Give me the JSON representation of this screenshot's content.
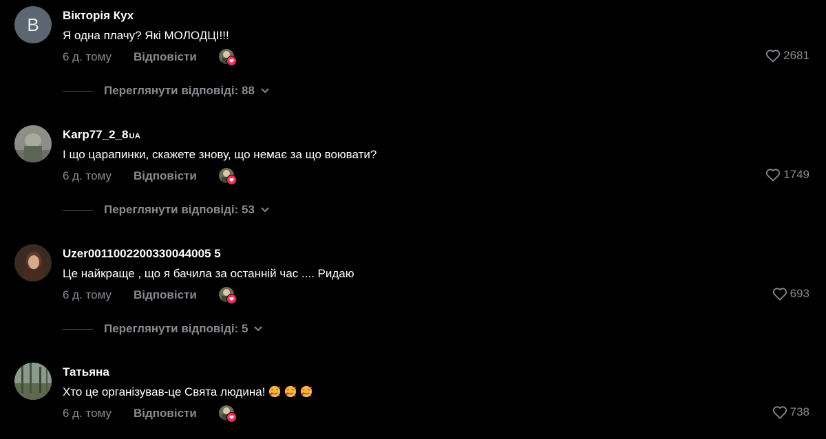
{
  "comments": [
    {
      "avatar_letter": "В",
      "username": "Вікторія Кух",
      "username_suffix": "",
      "text": "Я одна плачу? Які МОЛОДЦІ!!!",
      "time": "6 д. тому",
      "reply_label": "Відповісти",
      "likes": "2681",
      "view_replies": "Переглянути відповіді: 88"
    },
    {
      "avatar_letter": "",
      "username": "Karp77_2_8",
      "username_suffix": "UA",
      "text": "І що царапинки, скажете знову, що немає за що воювати?",
      "time": "6 д. тому",
      "reply_label": "Відповісти",
      "likes": "1749",
      "view_replies": "Переглянути відповіді: 53"
    },
    {
      "avatar_letter": "",
      "username": "Uzer0011002200330044005 5",
      "username_suffix": "",
      "text": "Це найкраще , що я бачила за останній час .... Ридаю",
      "time": "6 д. тому",
      "reply_label": "Відповісти",
      "likes": "693",
      "view_replies": "Переглянути відповіді: 5"
    },
    {
      "avatar_letter": "",
      "username": "Татьяна",
      "username_suffix": "",
      "text": "Хто це організував-це Свята людина!",
      "time": "6 д. тому",
      "reply_label": "Відповісти",
      "likes": "738",
      "view_replies": ""
    }
  ],
  "icons": {
    "like": "heart-outline-icon",
    "expand": "chevron-down-icon",
    "creator_liked": "creator-liked-badge-icon",
    "emoji": "smiling-face-with-hearts-emoji"
  },
  "colors": {
    "background": "#000000",
    "primary_text": "#ffffff",
    "secondary_text": "#8a8b91",
    "accent": "#fe2c55"
  }
}
